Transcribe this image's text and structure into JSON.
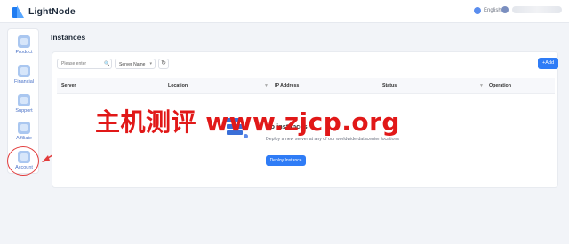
{
  "app": {
    "logo_text": "LightNode",
    "brand_color": "#1f7cf2"
  },
  "topbar": {
    "language_label": "English"
  },
  "sidebar": {
    "items": [
      {
        "label": "Product",
        "icon": "product-icon"
      },
      {
        "label": "Financial",
        "icon": "financial-icon"
      },
      {
        "label": "Support",
        "icon": "support-icon"
      },
      {
        "label": "Affiliate",
        "icon": "affiliate-icon"
      },
      {
        "label": "Account",
        "icon": "account-icon"
      }
    ]
  },
  "page": {
    "title": "Instances"
  },
  "toolbar": {
    "search_placeholder": "Please enter",
    "select_value": "Server Name",
    "add_label": "+Add"
  },
  "table": {
    "columns": [
      "Server",
      "Location",
      "IP Address",
      "Status",
      "Operation"
    ]
  },
  "empty_state": {
    "title": "No instances",
    "description": "Deploy a new server at any of our worldwide datacenter locations",
    "button_label": "Deploy Instance"
  },
  "watermark": {
    "text": "主机测评 www.zjcp.org",
    "color": "#e11818"
  }
}
